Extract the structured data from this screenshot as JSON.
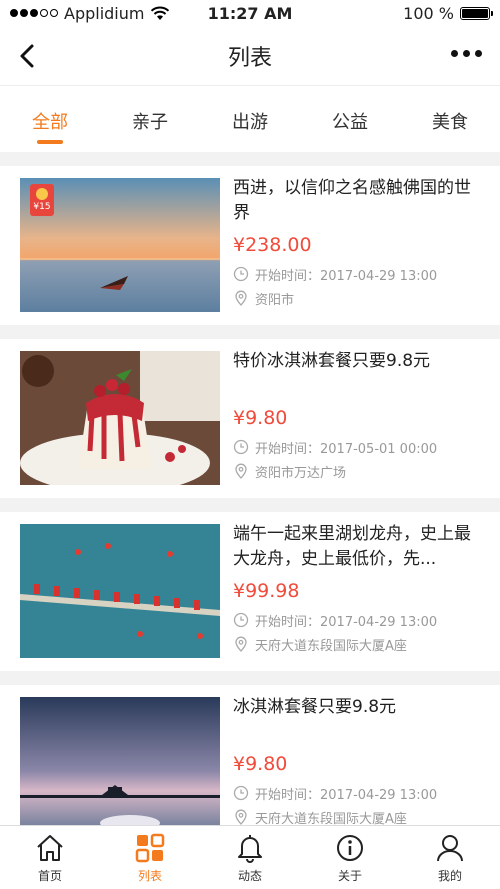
{
  "status_bar": {
    "carrier": "Applidium",
    "time": "11:27 AM",
    "battery": "100 %",
    "battery_level": 1.0
  },
  "nav": {
    "title": "列表"
  },
  "tabs": [
    {
      "label": "全部",
      "active": true
    },
    {
      "label": "亲子",
      "active": false
    },
    {
      "label": "出游",
      "active": false
    },
    {
      "label": "公益",
      "active": false
    },
    {
      "label": "美食",
      "active": false
    }
  ],
  "items": [
    {
      "title": "西进，以信仰之名感触佛国的世界",
      "price": "¥238.00",
      "time": "开始时间：2017-04-29 13:00",
      "location": "资阳市",
      "badge": "¥15",
      "image": "sunset-boat"
    },
    {
      "title": "特价冰淇淋套餐只要9.8元",
      "price": "¥9.80",
      "time": "开始时间：2017-05-01 00:00",
      "location": "资阳市万达广场",
      "image": "dessert"
    },
    {
      "title": "端午一起来里湖划龙舟，史上最大龙舟，史上最低价，先...",
      "price": "¥99.98",
      "time": "开始时间：2017-04-29 13:00",
      "location": "天府大道东段国际大厦A座",
      "image": "dragon-boat"
    },
    {
      "title": "冰淇淋套餐只要9.8元",
      "price": "¥9.80",
      "time": "开始时间：2017-04-29 13:00",
      "location": "天府大道东段国际大厦A座",
      "image": "pier"
    }
  ],
  "tabbar": [
    {
      "label": "首页",
      "icon": "home-icon",
      "active": false
    },
    {
      "label": "列表",
      "icon": "grid-icon",
      "active": true
    },
    {
      "label": "动态",
      "icon": "bell-icon",
      "active": false
    },
    {
      "label": "关于",
      "icon": "info-icon",
      "active": false
    },
    {
      "label": "我的",
      "icon": "person-icon",
      "active": false
    }
  ],
  "colors": {
    "accent": "#f37b1d",
    "price": "#f04b3b",
    "meta": "#999999"
  }
}
